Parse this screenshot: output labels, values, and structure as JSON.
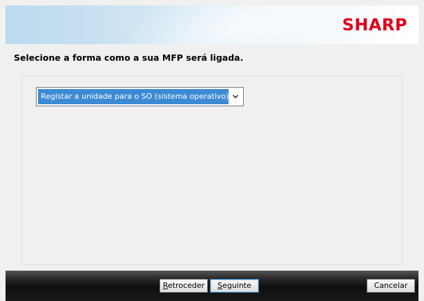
{
  "header": {
    "brand": "SHARP",
    "brand_color": "#e0001b"
  },
  "instruction": "Selecione a forma como a sua MFP será ligada.",
  "connection_select": {
    "selected": "Registar a unidade para o SO (sistema operativo)",
    "arrow_icon": "chevron-down-icon"
  },
  "buttons": {
    "back": {
      "mnemonic": "R",
      "rest": "etroceder"
    },
    "next": {
      "mnemonic": "S",
      "rest": "eguinte"
    },
    "cancel": "Cancelar"
  },
  "colors": {
    "selection": "#3d8ad4",
    "footer": "#1a1a1a"
  }
}
